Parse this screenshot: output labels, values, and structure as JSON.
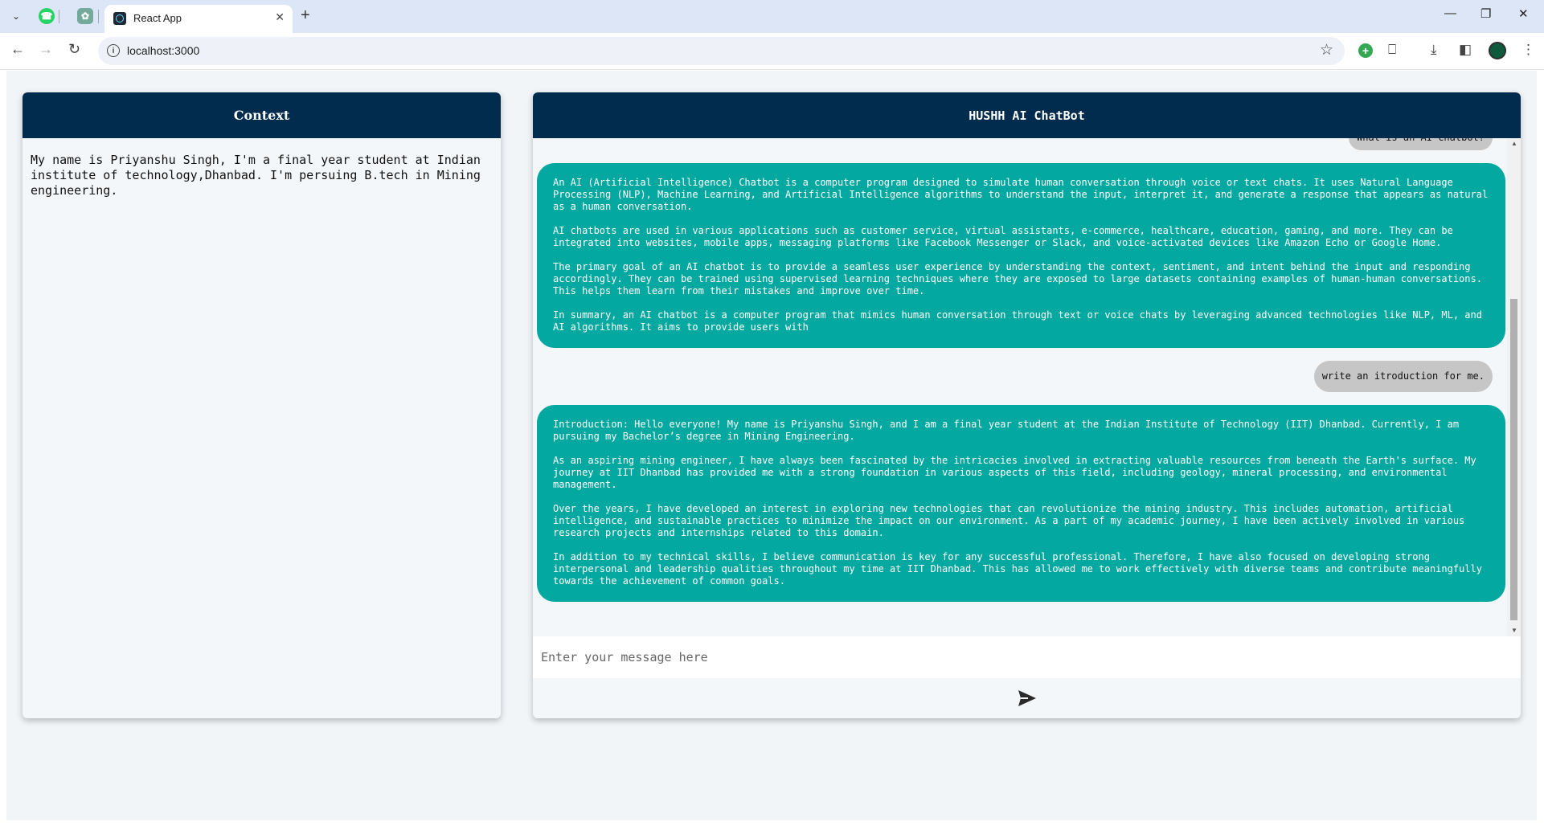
{
  "browser": {
    "tab_title": "React App",
    "url": "localhost:3000"
  },
  "context_panel": {
    "title": "Context",
    "text": "My name is Priyanshu Singh, I'm a final year student at Indian institute of technology,Dhanbad. I'm persuing B.tech in Mining engineering."
  },
  "chat": {
    "title": "HUSHH AI ChatBot",
    "messages": [
      {
        "role": "user",
        "text": "What is an AI chatbot?"
      },
      {
        "role": "ai",
        "paragraphs": [
          "An AI (Artificial Intelligence) Chatbot is a computer program designed to simulate human conversation through voice or text chats. It uses Natural Language Processing (NLP), Machine Learning, and Artificial Intelligence algorithms to understand the input, interpret it, and generate a response that appears as natural as a human conversation.",
          "AI chatbots are used in various applications such as customer service, virtual assistants, e-commerce, healthcare, education, gaming, and more. They can be integrated into websites, mobile apps, messaging platforms like Facebook Messenger or Slack, and voice-activated devices like Amazon Echo or Google Home.",
          "The primary goal of an AI chatbot is to provide a seamless user experience by understanding the context, sentiment, and intent behind the input and responding accordingly. They can be trained using supervised learning techniques where they are exposed to large datasets containing examples of human-human conversations. This helps them learn from their mistakes and improve over time.",
          "In summary, an AI chatbot is a computer program that mimics human conversation through text or voice chats by leveraging advanced technologies like NLP, ML, and AI algorithms. It aims to provide users with"
        ]
      },
      {
        "role": "user",
        "text": "write an itroduction for me."
      },
      {
        "role": "ai",
        "paragraphs": [
          "Introduction: Hello everyone! My name is Priyanshu Singh, and I am a final year student at the Indian Institute of Technology (IIT) Dhanbad. Currently, I am pursuing my Bachelor’s degree in Mining Engineering.",
          "As an aspiring mining engineer, I have always been fascinated by the intricacies involved in extracting valuable resources from beneath the Earth's surface. My journey at IIT Dhanbad has provided me with a strong foundation in various aspects of this field, including geology, mineral processing, and environmental management.",
          "Over the years, I have developed an interest in exploring new technologies that can revolutionize the mining industry. This includes automation, artificial intelligence, and sustainable practices to minimize the impact on our environment. As a part of my academic journey, I have been actively involved in various research projects and internships related to this domain.",
          "In addition to my technical skills, I believe communication is key for any successful professional. Therefore, I have also focused on developing strong interpersonal and leadership qualities throughout my time at IIT Dhanbad. This has allowed me to work effectively with diverse teams and contribute meaningfully towards the achievement of common goals."
        ]
      }
    ],
    "input_placeholder": "Enter your message here",
    "input_value": ""
  }
}
